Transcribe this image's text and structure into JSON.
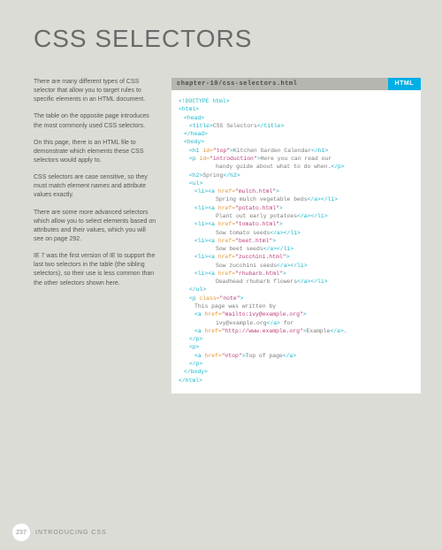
{
  "title": "CSS SELECTORS",
  "intro": {
    "p1": "There are many different types of CSS selector that allow you to target rules to specific elements in an HTML document.",
    "p2": "The table on the opposite page introduces the most commonly used CSS selectors.",
    "p3": "On this page, there is an HTML file to demonstrate which elements these CSS selectors would apply to.",
    "p4": "CSS selectors are case sensitive, so they must match element names and attribute values exactly.",
    "p5": "There are some more advanced selectors which allow you to select elements based on attributes and their values, which you will see on page 292.",
    "p6": "IE 7 was the first version of IE to support the last two selectors in the table (the sibling selectors), so their use is less common than the other selectors shown here."
  },
  "code": {
    "path": "chapter-10/css-selectors.html",
    "lang": "HTML",
    "doc": {
      "doctype": "<!DOCTYPE html>",
      "html_open": "<html>",
      "head_open": "<head>",
      "title_open": "<title>",
      "title_text": "CSS Selectors",
      "title_close": "</title>",
      "head_close": "</head>",
      "body_open": "<body>",
      "h1_open": "<h1 ",
      "h1_attr": "id=",
      "h1_val": "\"top\"",
      "h1_close_tag": ">",
      "h1_text": "Kitchen Garden Calendar",
      "h1_close": "</h1>",
      "p1_open": "<p ",
      "p1_attr": "id=",
      "p1_val": "\"introduction\"",
      "p1_close_tag": ">",
      "p1_text1": "Here you can read our",
      "p1_text2": "handy guide about what to do when.",
      "p1_close": "</p>",
      "h2_open": "<h2>",
      "h2_text": "Spring",
      "h2_close": "</h2>",
      "ul_open": "<ul>",
      "li_open": "<li>",
      "a_open": "<a ",
      "href": "href=",
      "a_close_tag": ">",
      "a_close": "</a>",
      "li_close": "</li>",
      "links": {
        "mulch": {
          "href": "\"mulch.html\"",
          "text": "Spring mulch vegetable beds"
        },
        "potato": {
          "href": "\"potato.html\"",
          "text": "Plant out early potatoes"
        },
        "tomato": {
          "href": "\"tomato.html\"",
          "text": "Sow tomato seeds"
        },
        "beet": {
          "href": "\"beet.html\"",
          "text": "Sow beet seeds"
        },
        "zucchini": {
          "href": "\"zucchini.html\"",
          "text": "Sow zucchini seeds"
        },
        "rhubarb": {
          "href": "\"rhubarb.html\"",
          "text": "Deadhead rhubarb flowers"
        }
      },
      "ul_close": "</ul>",
      "pnote_open": "<p ",
      "pnote_attr": "class=",
      "pnote_val": "\"note\"",
      "pnote_text1": "This page was written by",
      "mailto_val": "\"mailto:ivy@example.org\"",
      "mailto_text": "ivy@example.org",
      "for_text": " for",
      "site_val": "\"http://www.example.org\"",
      "site_text": "Example",
      "period": ".",
      "p_close": "</p>",
      "p_open": "<p>",
      "top_val": "\"#top\"",
      "top_text": "Top of page",
      "body_close": "</body>",
      "html_close": "</html>"
    }
  },
  "footer": {
    "page": "237",
    "chapter": "INTRODUCING CSS"
  }
}
